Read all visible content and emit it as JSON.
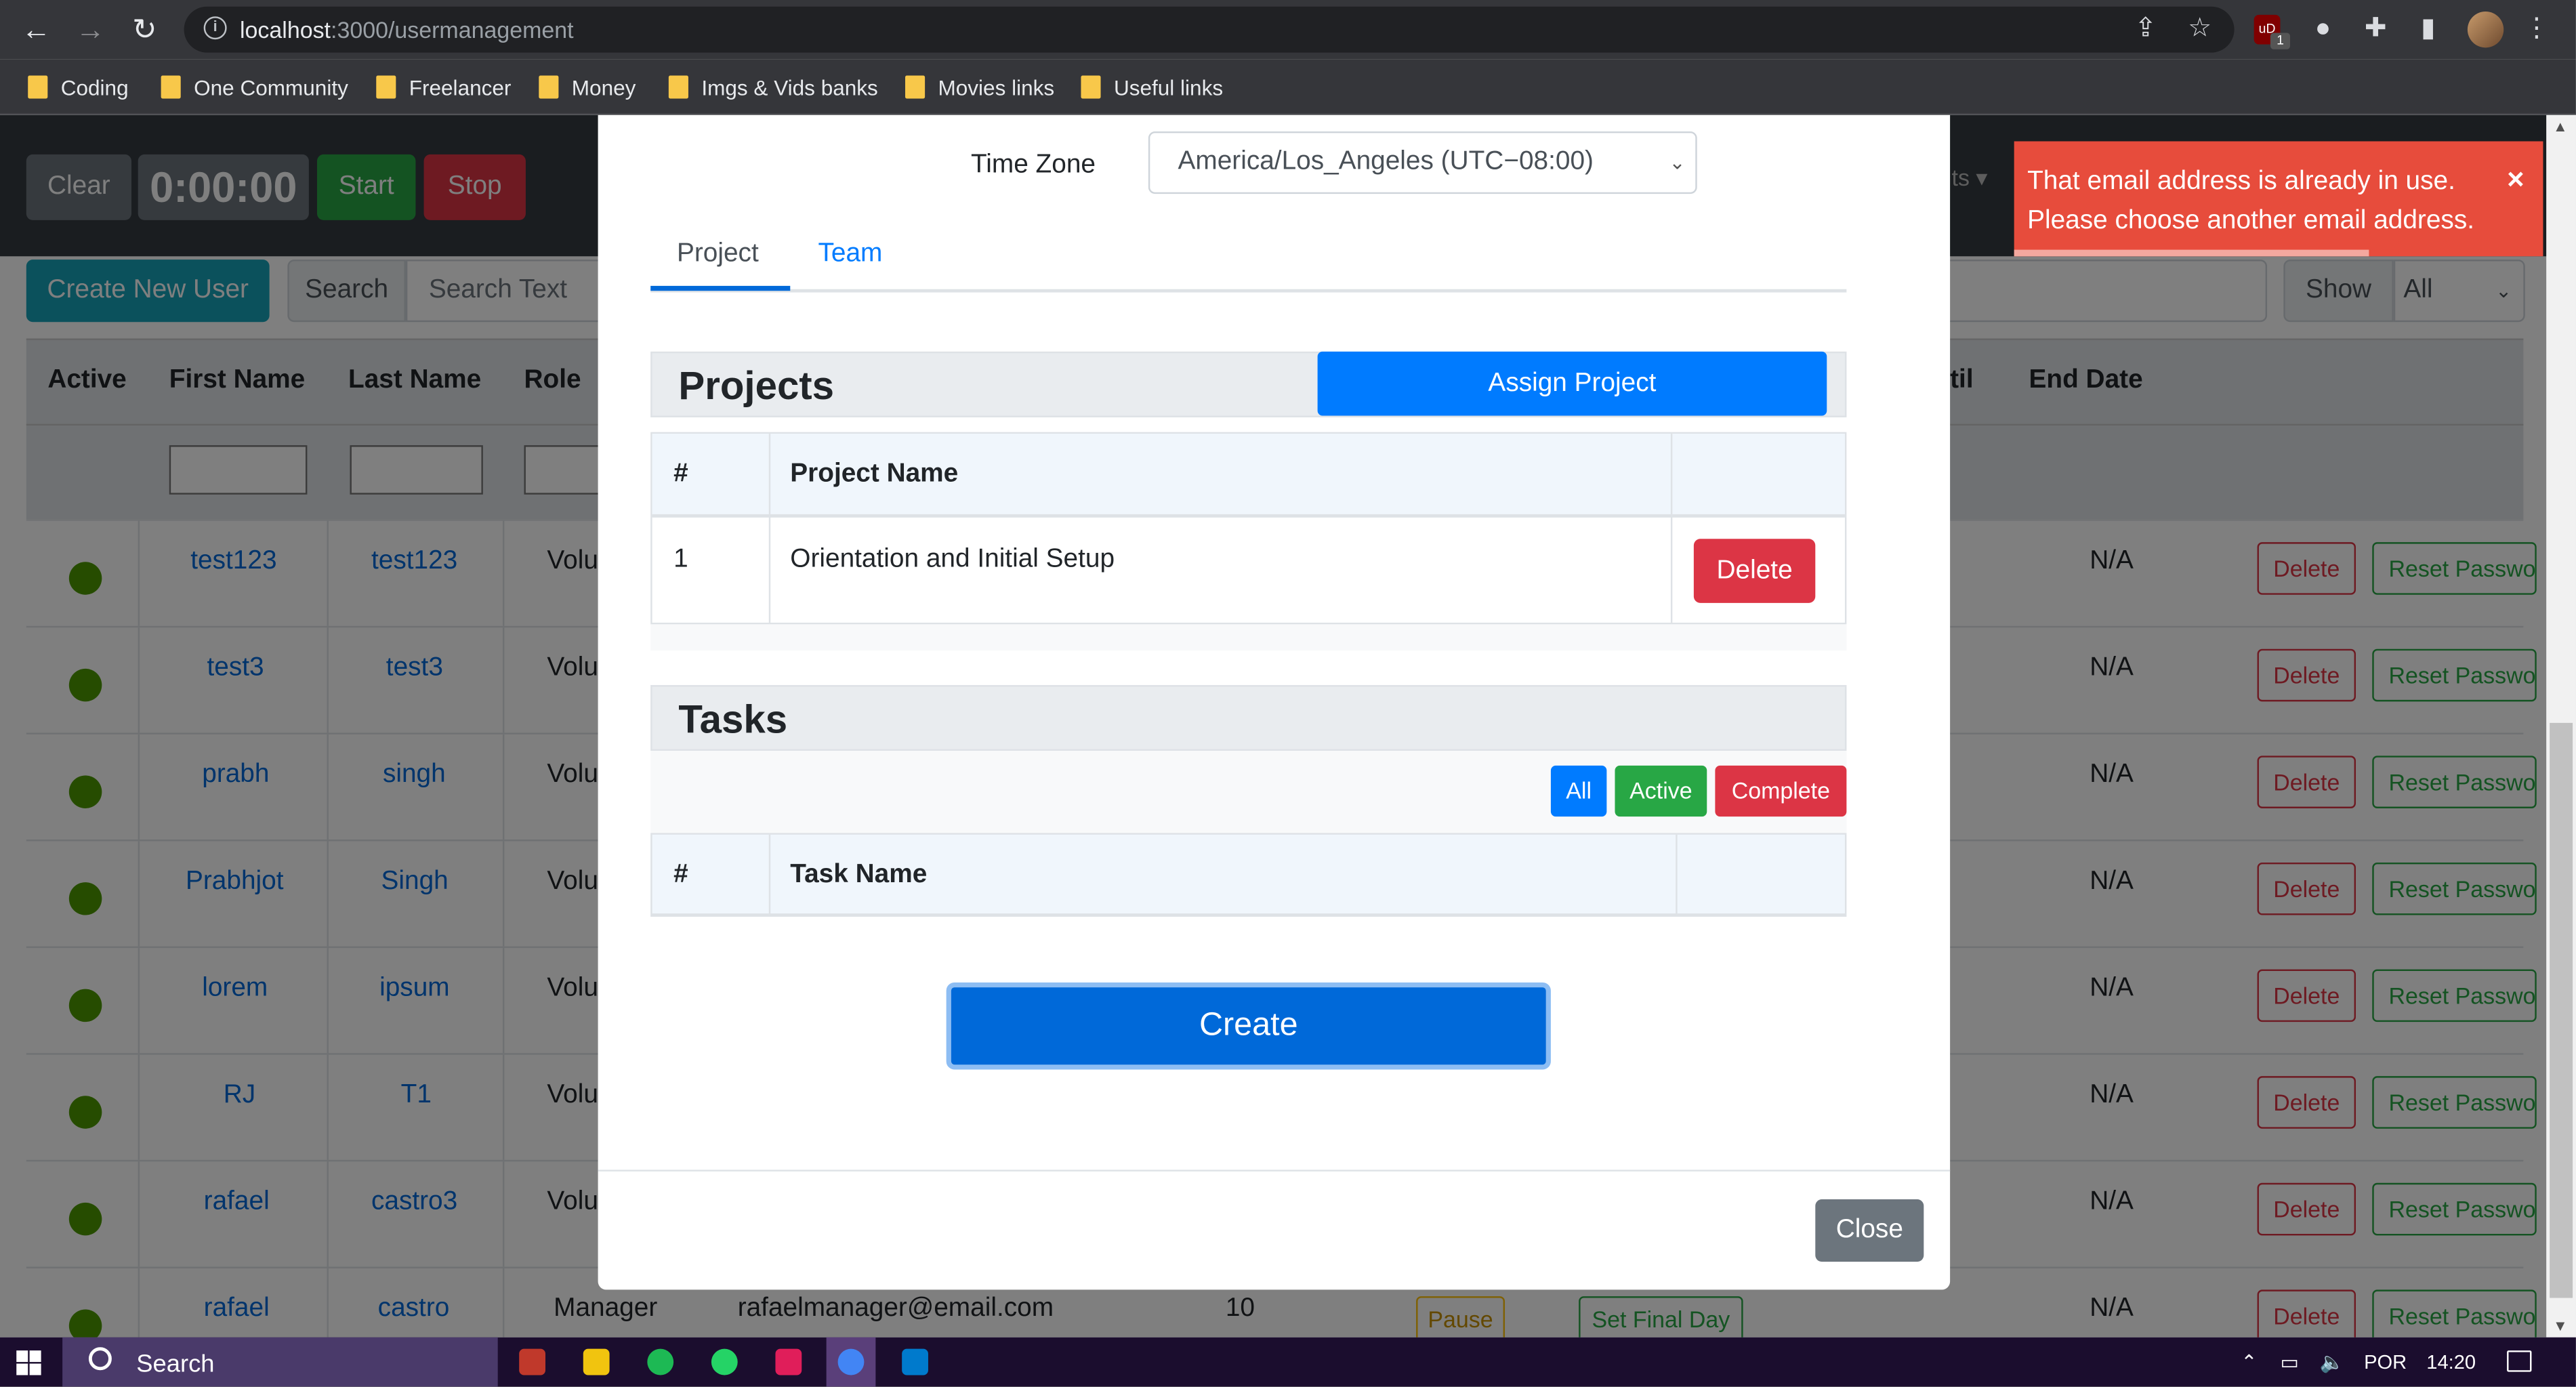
{
  "browser": {
    "url_prefix": "localhost",
    "url_rest": ":3000/usermanagement",
    "ext_ublock_label": "uD",
    "ext_badge": "1",
    "bookmarks": [
      "Coding",
      "One Community",
      "Freelancer",
      "Money",
      "Imgs & Vids banks",
      "Movies links",
      "Useful links"
    ]
  },
  "timer": {
    "clear": "Clear",
    "display": "0:00:00",
    "start": "Start",
    "stop": "Stop"
  },
  "navbar": {
    "partial_item": "ts"
  },
  "toolbar": {
    "create_label": "Create New User",
    "search_label": "Search",
    "search_placeholder": "Search Text",
    "show_label": "Show",
    "show_value": "All"
  },
  "table": {
    "headers": [
      "Active",
      "First Name",
      "Last Name",
      "Role",
      "til",
      "End Date"
    ],
    "rows": [
      {
        "first": "test123",
        "last": "test123",
        "role": "Volu",
        "end": "N/A"
      },
      {
        "first": "test3",
        "last": "test3",
        "role": "Volu",
        "end": "N/A"
      },
      {
        "first": "prabh",
        "last": "singh",
        "role": "Volu",
        "end": "N/A"
      },
      {
        "first": "Prabhjot",
        "last": "Singh",
        "role": "Volu",
        "end": "N/A"
      },
      {
        "first": "lorem",
        "last": "ipsum",
        "role": "Volu",
        "end": "N/A"
      },
      {
        "first": "RJ",
        "last": "T1",
        "role": "Volu",
        "end": "N/A"
      },
      {
        "first": "rafael",
        "last": "castro3",
        "role": "Volu",
        "end": "N/A"
      },
      {
        "first": "rafael",
        "last": "castro",
        "role": "Manager",
        "email": "rafaelmanager@email.com",
        "hours": "10",
        "pause": "Pause",
        "final": "Set Final Day",
        "end": "N/A"
      }
    ],
    "delete_label": "Delete",
    "reset_label": "Reset Password"
  },
  "modal": {
    "tz_label": "Time Zone",
    "tz_value": "America/Los_Angeles (UTC−08:00)",
    "tabs": [
      "Project",
      "Team"
    ],
    "projects_title": "Projects",
    "assign_label": "Assign Project",
    "project_headers": [
      "#",
      "Project Name"
    ],
    "projects": [
      {
        "num": "1",
        "name": "Orientation and Initial Setup"
      }
    ],
    "project_delete": "Delete",
    "tasks_title": "Tasks",
    "task_filters": [
      "All",
      "Active",
      "Complete"
    ],
    "task_headers": [
      "#",
      "Task Name"
    ],
    "create_label": "Create",
    "close_label": "Close"
  },
  "toast": {
    "line1": "That email address is already in use.",
    "line2": "Please choose another email address.",
    "close": "×"
  },
  "taskbar": {
    "search_label": "Search",
    "lang": "POR",
    "time": "14:20"
  },
  "colors": {
    "primary": "#007bff",
    "danger": "#dc3545",
    "success": "#28a745",
    "toast": "#e74c3c",
    "navbar": "#343a40"
  }
}
